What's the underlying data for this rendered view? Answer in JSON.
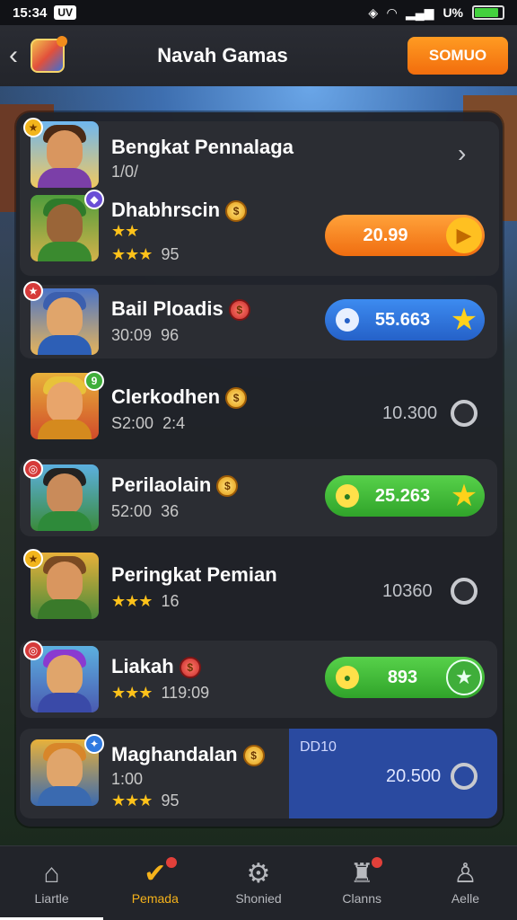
{
  "status_bar": {
    "time": "15:34",
    "badge": "UV",
    "battery": "U%"
  },
  "header": {
    "title": "Navah Gamas",
    "button_label": "SOMUO"
  },
  "rows": [
    {
      "title": "Bengkat Pennalaga",
      "sub": "1/0/",
      "kind": "chevron"
    },
    {
      "title": "Dhabhrscin",
      "stars": "★★",
      "stars2": "★★★",
      "sub_value": "95",
      "pill_value": "20.99",
      "pill_color": "orange"
    },
    {
      "title": "Bail Ploadis",
      "sub_left": "30:09",
      "sub_value": "96",
      "pill_value": "55.663",
      "pill_color": "blue"
    },
    {
      "title": "Clerkodhen",
      "sub_left": "S2:00",
      "sub_value": "2:4",
      "plain_value": "10.300"
    },
    {
      "title": "Perilaolain",
      "sub_left": "52:00",
      "sub_value": "36",
      "pill_value": "25.263",
      "pill_color": "green"
    },
    {
      "title": "Peringkat Pemian",
      "stars": "★★★",
      "sub_value": "16",
      "plain_value": "10360"
    },
    {
      "title": "Liakah",
      "stars": "★★★",
      "sub_value": "119:09",
      "pill_value": "893",
      "pill_color": "green"
    },
    {
      "title": "Maghandalan",
      "sub_left": "1:00",
      "stars": "★★★",
      "sub_value": "95",
      "card_label": "DD10",
      "plain_value": "20.500"
    }
  ],
  "nav": [
    {
      "label": "Liartle",
      "icon": "home-icon"
    },
    {
      "label": "Pemada",
      "icon": "trophy-icon"
    },
    {
      "label": "Shonied",
      "icon": "gear-icon"
    },
    {
      "label": "Clanns",
      "icon": "castle-icon"
    },
    {
      "label": "Aelle",
      "icon": "profile-icon"
    }
  ],
  "colors": {
    "accent_orange": "#f26d0d",
    "accent_green": "#30a42a",
    "accent_blue": "#2561c8",
    "active_nav": "#f5b21b"
  }
}
